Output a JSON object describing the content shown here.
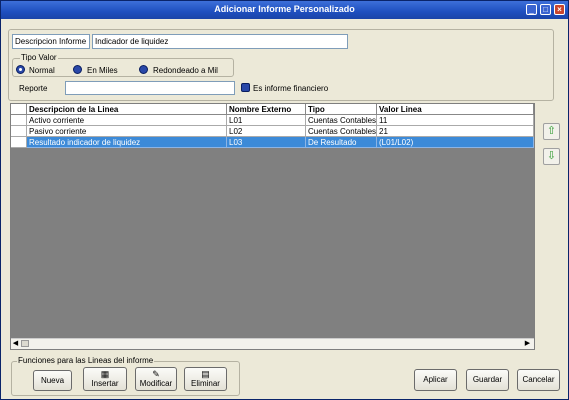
{
  "window": {
    "title": "Adicionar Informe Personalizado"
  },
  "form": {
    "descripcion_label": "Descripcion Informe",
    "descripcion_value": "Indicador de liquidez",
    "tipo_valor_label": "Tipo Valor",
    "radios": [
      {
        "label": "Normal",
        "selected": true
      },
      {
        "label": "En Miles",
        "selected": false
      },
      {
        "label": "Redondeado a Mil",
        "selected": false
      }
    ],
    "reporte_label": "Reporte",
    "reporte_value": "",
    "financiero_label": "Es informe financiero",
    "financiero_checked": true
  },
  "grid": {
    "columns": [
      "Descripcion de la Linea",
      "Nombre Externo",
      "Tipo",
      "Valor Linea"
    ],
    "rows": [
      [
        "Activo corriente",
        "L01",
        "Cuentas Contables",
        "11"
      ],
      [
        "Pasivo corriente",
        "L02",
        "Cuentas Contables",
        "21"
      ],
      [
        "Resultado indicador de liquidez",
        "L03",
        "De Resultado",
        "(L01/L02)"
      ]
    ],
    "selected_row": 2
  },
  "side_buttons": {
    "up_icon": "arrow-up-icon",
    "down_icon": "arrow-down-icon"
  },
  "funciones": {
    "label": "Funciones para las Lineas del informe",
    "nueva": "Nueva",
    "insertar": "Insertar",
    "modificar": "Modificar",
    "eliminar": "Eliminar"
  },
  "actions": {
    "aplicar": "Aplicar",
    "guardar": "Guardar",
    "cancelar": "Cancelar"
  },
  "colors": {
    "titlebar": "#1e4fbf",
    "selection": "#3c8ad8",
    "grid_bg": "#808080"
  }
}
